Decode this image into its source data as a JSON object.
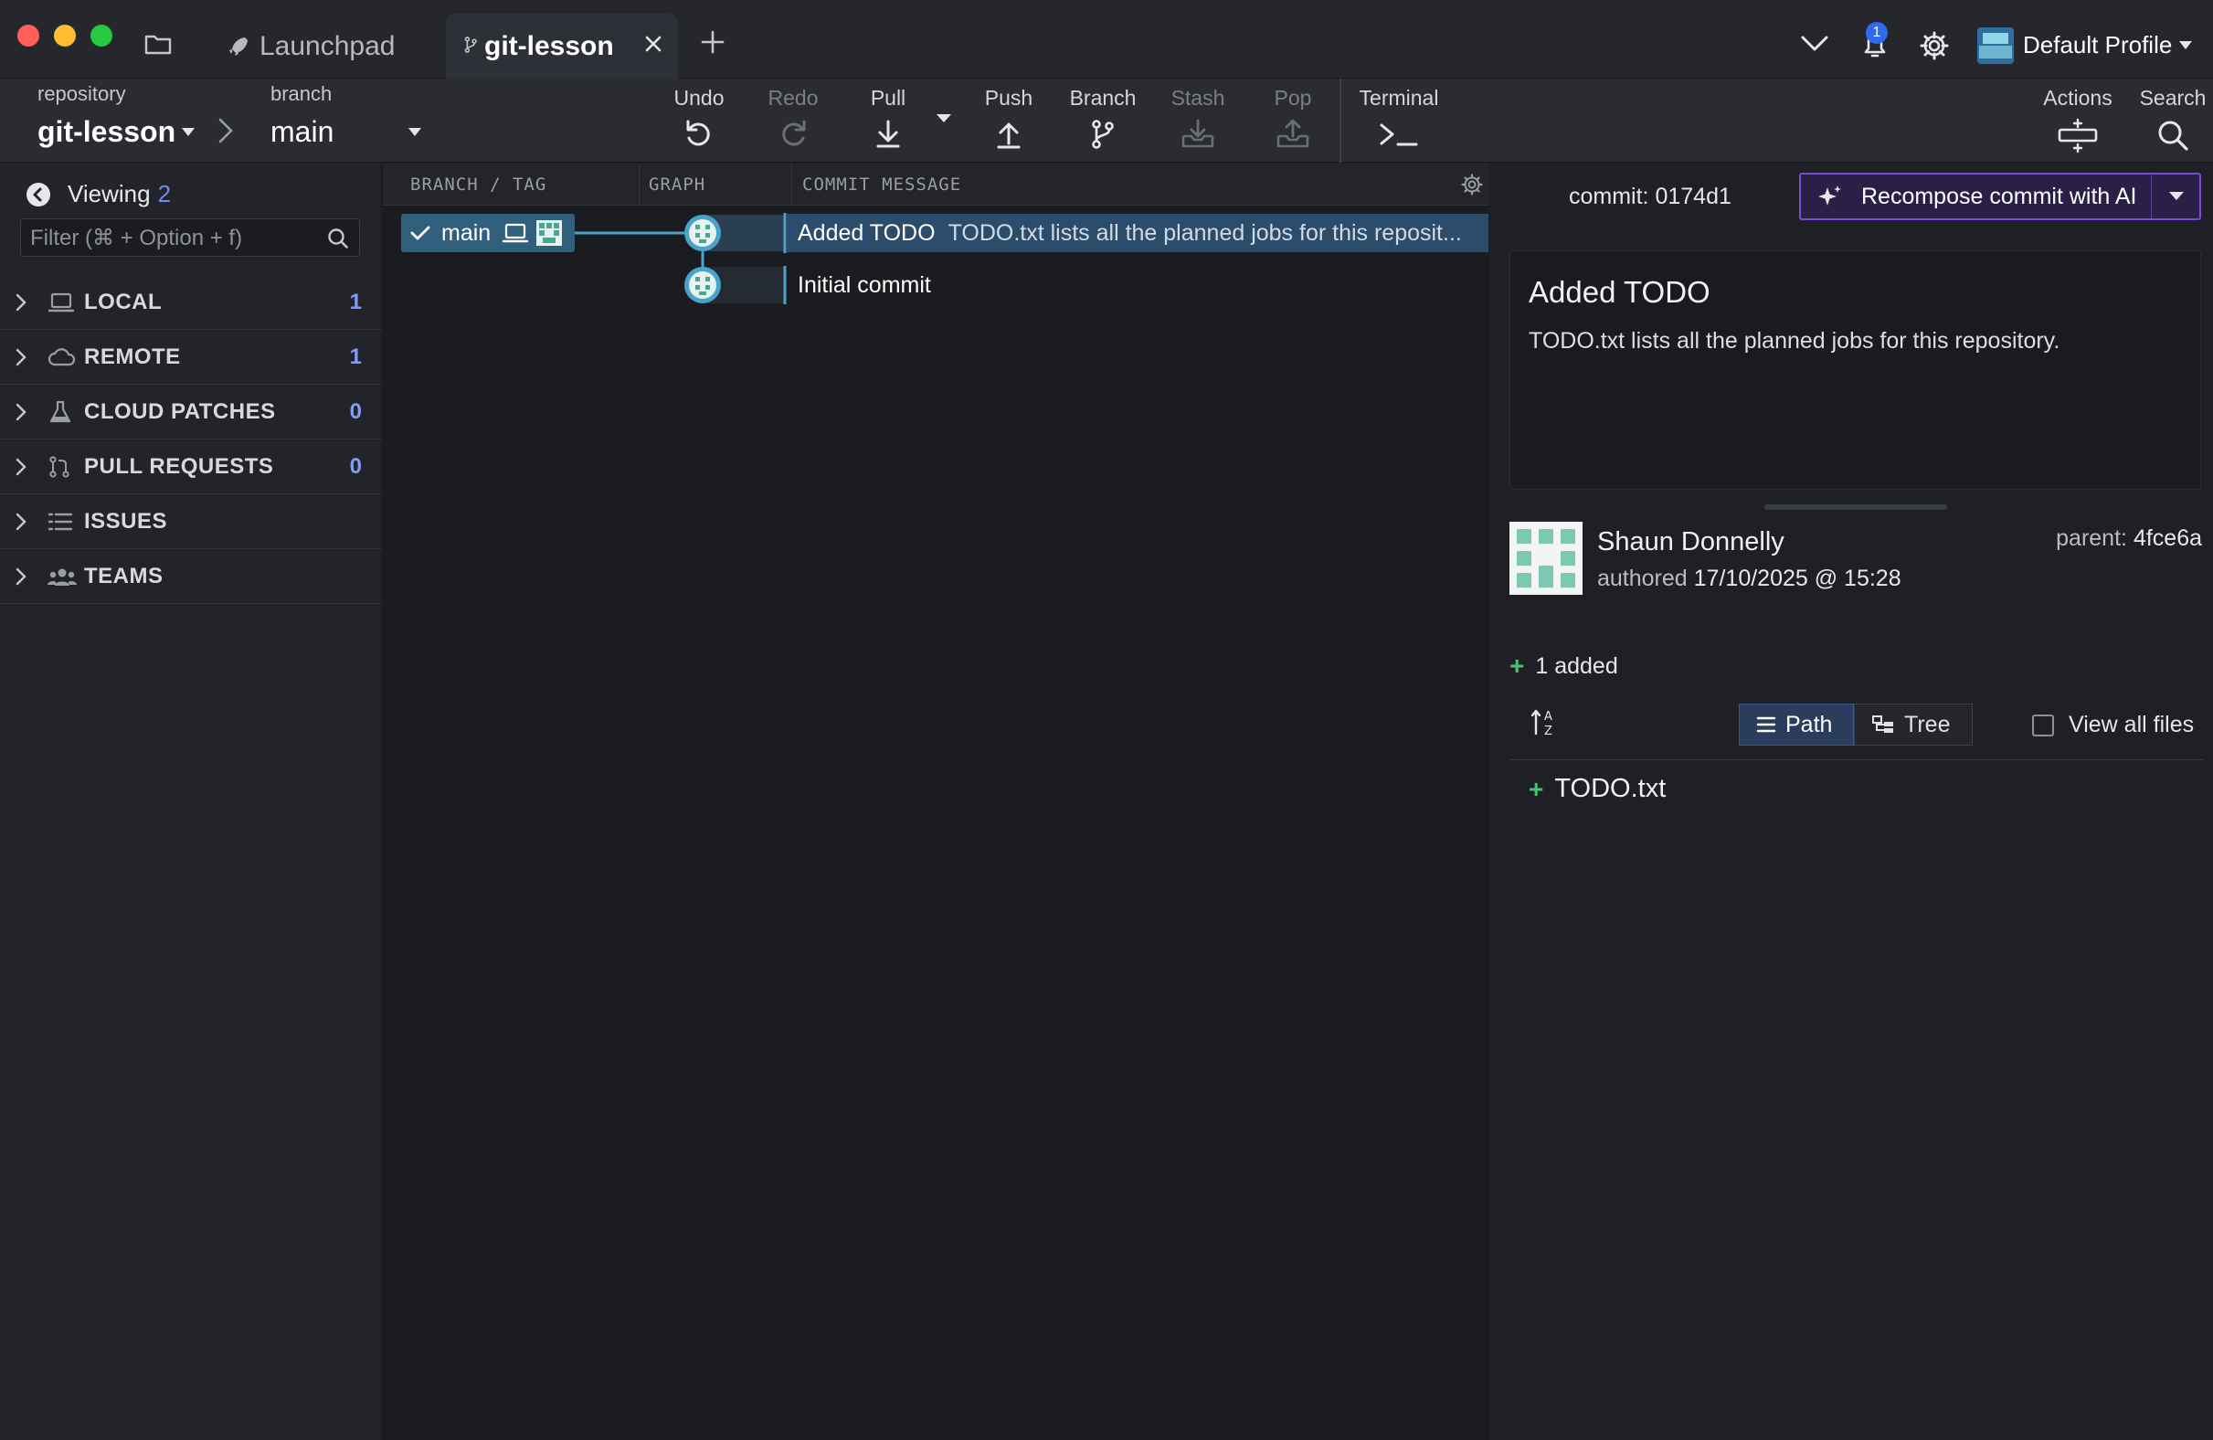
{
  "titlebar": {
    "tabs": [
      {
        "label": "Launchpad",
        "icon": "rocket-icon"
      },
      {
        "label": "git-lesson",
        "icon": "branch-icon",
        "active": true
      }
    ],
    "notifications_count": "1",
    "profile_name": "Default Profile"
  },
  "toolbar": {
    "repository_label": "repository",
    "repository": "git-lesson",
    "branch_label": "branch",
    "branch": "main",
    "buttons": {
      "undo": "Undo",
      "redo": "Redo",
      "pull": "Pull",
      "push": "Push",
      "branch": "Branch",
      "stash": "Stash",
      "pop": "Pop",
      "terminal": "Terminal",
      "actions": "Actions",
      "search": "Search"
    }
  },
  "sidebar": {
    "viewing_label": "Viewing",
    "viewing_count": "2",
    "filter_placeholder": "Filter (⌘ + Option + f)",
    "sections": [
      {
        "label": "LOCAL",
        "count": "1",
        "icon": "laptop-icon"
      },
      {
        "label": "REMOTE",
        "count": "1",
        "icon": "cloud-icon"
      },
      {
        "label": "CLOUD PATCHES",
        "count": "0",
        "icon": "flask-icon"
      },
      {
        "label": "PULL REQUESTS",
        "count": "0",
        "icon": "pull-request-icon"
      },
      {
        "label": "ISSUES",
        "count": "",
        "icon": "list-icon"
      },
      {
        "label": "TEAMS",
        "count": "",
        "icon": "people-icon"
      }
    ]
  },
  "graph": {
    "columns": {
      "branch_tag": "BRANCH / TAG",
      "graph": "GRAPH",
      "commit_message": "COMMIT MESSAGE"
    },
    "branch_chip": "main",
    "commits": [
      {
        "summary": "Added TODO",
        "description": "TODO.txt lists all the planned jobs for this reposit...",
        "selected": true
      },
      {
        "summary": "Initial commit",
        "description": "",
        "selected": false
      }
    ]
  },
  "detail": {
    "commit_label": "commit:",
    "commit_sha": "0174d1",
    "recompose_label": "Recompose commit with AI",
    "summary": "Added TODO",
    "body": "TODO.txt lists all the planned jobs for this repository.",
    "author": "Shaun Donnelly",
    "authored_label": "authored",
    "authored_date": "17/10/2025 @ 15:28",
    "parent_label": "parent:",
    "parent_sha": "4fce6a",
    "added_summary": "1 added",
    "view_path": "Path",
    "view_tree": "Tree",
    "view_all_files": "View all files",
    "files": [
      {
        "name": "TODO.txt",
        "status": "added"
      }
    ]
  },
  "colors": {
    "accent_blue": "#2e6bf0",
    "selection": "#2c4c6c",
    "branch_chip": "#31607f",
    "ai_border": "#7a4ad8",
    "added_green": "#47c46b",
    "count_blue": "#7e9cf8"
  }
}
